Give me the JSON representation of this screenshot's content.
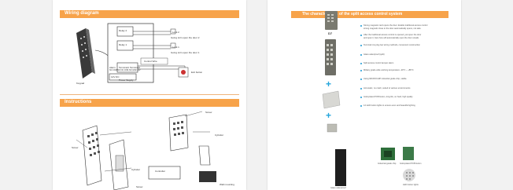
{
  "wiring": {
    "title": "Wiring diagram",
    "relay1": "Relay 1",
    "relay2": "Relay 2",
    "lock2": "Lock 2",
    "lock2_note": "Going to/in open the door 2",
    "lock1": "Lock 1",
    "lock1_note": "Going to/in open the door 1",
    "exit_note": "Exit button",
    "terminal_labels": [
      "Alarm",
      "Terminal1",
      "Terminal2"
    ],
    "terminal_pins": "NC COM NO  NC COM NO  GND 12V",
    "power_label": "12V DC",
    "power_supply": "Power Supply",
    "wire_note": "Control Wire",
    "keypad_label": "Keypad"
  },
  "instructions": {
    "title": "Instructions",
    "screw_labels": [
      "Screw",
      "Screw",
      "Screw"
    ],
    "cylinder_labels": [
      "Cylinder",
      "Cylinder"
    ],
    "controller_label": "Controller",
    "wall_mounting": "Wall mounting"
  },
  "right": {
    "title": "The characteristics of the split access control system",
    "product_code": "D7",
    "features": [
      "Strong magnetic card opens the door. Enable traditional access control",
      "strong magnetic close to the door automatically opens, not safe.",
      "After the traditional access control is opened, just open the door",
      "and open it, fans how will automatically open the door unsafe.",
      "Terminal row plug two wiring methods, convenient construction",
      "Glass waterproof (split)",
      "Split access control tamper alarm",
      "Military grade wide working temperature -40°C ~ +85°C",
      "Using MICROCHIP industrial grade chip, stable.",
      "Anti-static, no crash, suited to various environments",
      "Gold-plated PCB button, long life, no hard, high quality",
      "12 LED button lights to ensure even and beautiful lighting"
    ],
    "captions": {
      "glass": "Glass waterproof",
      "chip": "Industrial grade chip",
      "pcb": "Gold-plated PCB button",
      "led": "LED button lights"
    }
  }
}
